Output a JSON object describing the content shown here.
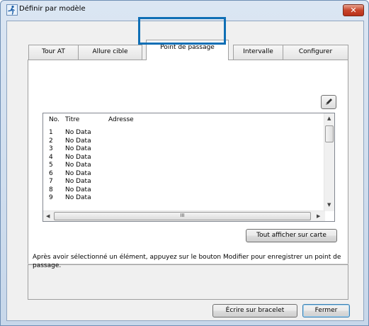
{
  "window": {
    "title": "Définir par modèle",
    "close_label": "✕"
  },
  "tabs": [
    {
      "label": "Tour AT"
    },
    {
      "label": "Allure cible"
    },
    {
      "label": "Point de passage"
    },
    {
      "label": "Intervalle"
    },
    {
      "label": "Configurer"
    }
  ],
  "list": {
    "columns": {
      "no": "No.",
      "title": "Titre",
      "address": "Adresse"
    },
    "rows": [
      {
        "no": "1",
        "title": "No Data"
      },
      {
        "no": "2",
        "title": "No Data"
      },
      {
        "no": "3",
        "title": "No Data"
      },
      {
        "no": "4",
        "title": "No Data"
      },
      {
        "no": "5",
        "title": "No Data"
      },
      {
        "no": "6",
        "title": "No Data"
      },
      {
        "no": "7",
        "title": "No Data"
      },
      {
        "no": "8",
        "title": "No Data"
      },
      {
        "no": "9",
        "title": "No Data"
      }
    ],
    "hscroll_grip": "III"
  },
  "buttons": {
    "show_all": "Tout afficher sur carte",
    "write": "Écrire sur bracelet",
    "close": "Fermer"
  },
  "hint": "Après avoir sélectionné un élément, appuyez sur le bouton Modifier pour enregistrer un point de passage.",
  "icons": {
    "edit": "pencil-icon",
    "app": "runner-icon"
  },
  "colors": {
    "highlight": "#0f6fb5",
    "close_button": "#c8452a"
  }
}
